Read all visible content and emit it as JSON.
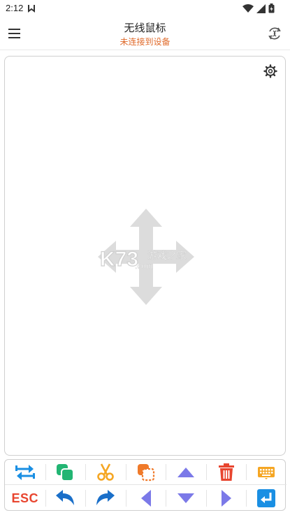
{
  "status_bar": {
    "time": "2:12"
  },
  "header": {
    "title": "无线鼠标",
    "subtitle": "未连接到设备"
  },
  "watermark": {
    "text": "K73",
    "sub": "游戏之家",
    "domain": ".com"
  },
  "keyboard": {
    "row1": [
      "switch-windows-icon",
      "copy-icon",
      "cut-icon",
      "paste-icon",
      "arrow-up-icon",
      "delete-icon",
      "keyboard-icon"
    ],
    "row2": [
      "esc-key",
      "undo-icon",
      "redo-icon",
      "arrow-left-icon",
      "arrow-down-icon",
      "arrow-right-icon",
      "enter-icon"
    ],
    "esc_label": "ESC"
  },
  "colors": {
    "accent_blue": "#1a8fe3",
    "green": "#22b573",
    "orange": "#f5a623",
    "paste_orange": "#f07a2a",
    "purple": "#7b79e8",
    "red": "#e8452f",
    "subtitle": "#e06a2a"
  }
}
